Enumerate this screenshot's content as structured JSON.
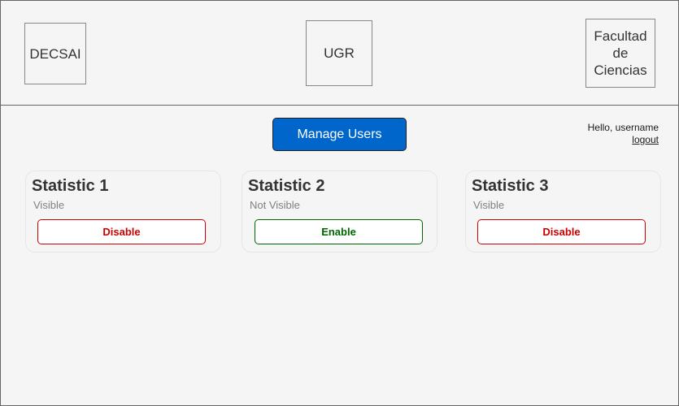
{
  "header": {
    "logos": [
      {
        "label": "DECSAI"
      },
      {
        "label": "UGR"
      },
      {
        "label": "Facultad de Ciencias"
      }
    ]
  },
  "toolbar": {
    "manage_users_label": "Manage Users"
  },
  "user": {
    "greeting": "Hello, username",
    "logout_label": "logout"
  },
  "statistics": [
    {
      "title": "Statistic 1",
      "status": "Visible",
      "action_label": "Disable"
    },
    {
      "title": "Statistic 2",
      "status": "Not Visible",
      "action_label": "Enable"
    },
    {
      "title": "Statistic 3",
      "status": "Visible",
      "action_label": "Disable"
    }
  ],
  "colors": {
    "primary": "#0066cc",
    "disable": "#cc0000",
    "enable": "#006600",
    "muted_text": "#808080",
    "background": "#f5f5f5"
  }
}
